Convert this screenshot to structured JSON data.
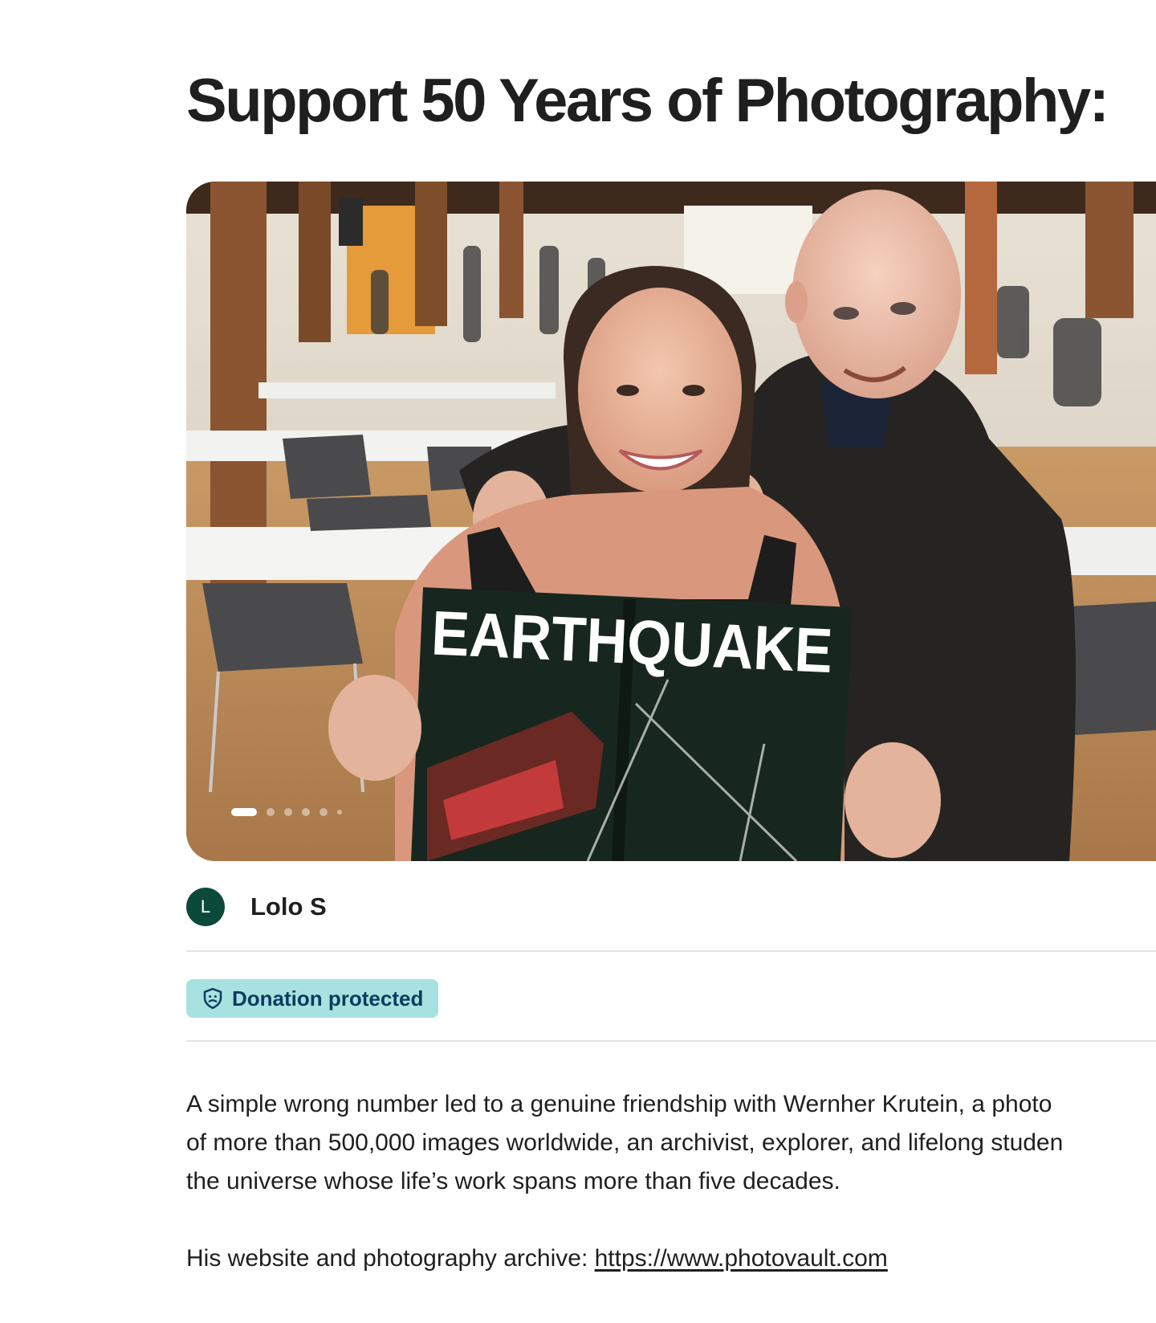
{
  "campaign": {
    "title": "Support 50 Years of Photography:"
  },
  "hero": {
    "magazine_headline": "EARTHQUAKE",
    "carousel_dots": 6,
    "carousel_active_index": 0
  },
  "organizer": {
    "initial": "L",
    "name": "Lolo S",
    "avatar_color": "#0b4a3b"
  },
  "badge": {
    "label": "Donation protected",
    "icon": "shield-icon",
    "background": "#a8e2e0",
    "color": "#0d3b5e"
  },
  "story": {
    "lines": [
      "A simple wrong number led to a genuine friendship with Wernher Krutein, a photo",
      "of more than 500,000 images worldwide, an archivist, explorer, and lifelong studen",
      "the universe whose life’s work spans more than five decades."
    ],
    "website_prefix": "His website and photography archive: ",
    "website_link": "https://www.photovault.com"
  }
}
